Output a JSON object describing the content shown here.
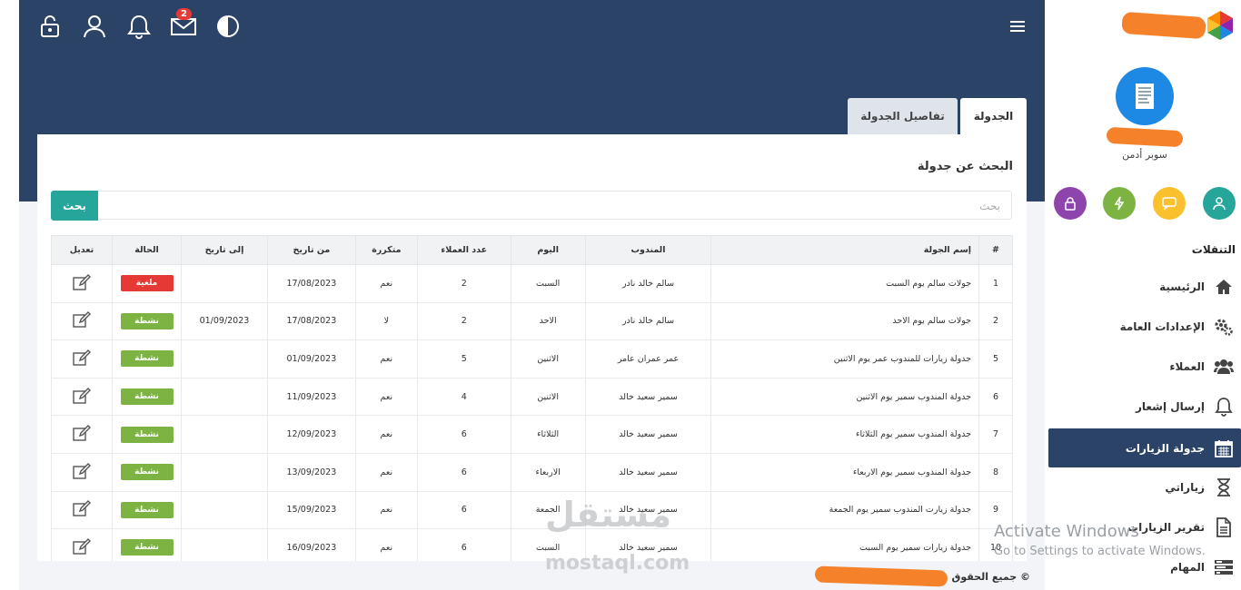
{
  "topbar": {
    "mail_badge": "2"
  },
  "sidebar": {
    "role": "سوبر أدمن",
    "nav_header": "التنقلات",
    "items": [
      {
        "label": "الرئيسية",
        "icon": "home-icon"
      },
      {
        "label": "الإعدادات العامة",
        "icon": "gears-icon"
      },
      {
        "label": "العملاء",
        "icon": "users-icon"
      },
      {
        "label": "إرسال إشعار",
        "icon": "bell-icon"
      },
      {
        "label": "جدولة الزيارات",
        "icon": "calendar-icon"
      },
      {
        "label": "زياراتي",
        "icon": "hourglass-icon"
      },
      {
        "label": "تقرير الزيارات",
        "icon": "file-icon"
      },
      {
        "label": "المهام",
        "icon": "tasks-icon"
      }
    ]
  },
  "tabs": {
    "active": "الجدولة",
    "other": "تفاصيل الجدولة"
  },
  "card": {
    "title": "البحث عن جدولة",
    "search_placeholder": "بحث",
    "search_button": "بحث"
  },
  "table": {
    "headers": {
      "num": "#",
      "name": "إسم الجولة",
      "rep": "المندوب",
      "day": "اليوم",
      "clients": "عدد العملاء",
      "recurring": "متكررة",
      "from": "من تاريخ",
      "to": "إلى تاريخ",
      "status": "الحالة",
      "edit": "تعديل"
    },
    "rows": [
      {
        "num": "1",
        "name": "جولات سالم يوم السبت",
        "rep": "سالم خالد نادر",
        "day": "السبت",
        "clients": "2",
        "recurring": "نعم",
        "from": "17/08/2023",
        "to": "",
        "status": "ملغية",
        "status_color": "#e53935"
      },
      {
        "num": "2",
        "name": "جولات سالم يوم الاحد",
        "rep": "سالم خالد نادر",
        "day": "الاحد",
        "clients": "2",
        "recurring": "لا",
        "from": "17/08/2023",
        "to": "01/09/2023",
        "status": "نشطة",
        "status_color": "#7cb342"
      },
      {
        "num": "5",
        "name": "جدولة زيارات للمندوب عمر يوم الاثنين",
        "rep": "عمر عمران عامر",
        "day": "الاثنين",
        "clients": "5",
        "recurring": "نعم",
        "from": "01/09/2023",
        "to": "",
        "status": "نشطة",
        "status_color": "#7cb342"
      },
      {
        "num": "6",
        "name": "جدولة المندوب سمير يوم الاثنين",
        "rep": "سمير سعيد خالد",
        "day": "الاثنين",
        "clients": "4",
        "recurring": "نعم",
        "from": "11/09/2023",
        "to": "",
        "status": "نشطة",
        "status_color": "#7cb342"
      },
      {
        "num": "7",
        "name": "جدولة المندوب سمير يوم الثلاثاء",
        "rep": "سمير سعيد خالد",
        "day": "الثلاثاء",
        "clients": "6",
        "recurring": "نعم",
        "from": "12/09/2023",
        "to": "",
        "status": "نشطة",
        "status_color": "#7cb342"
      },
      {
        "num": "8",
        "name": "جدولة المندوب سمير يوم الاربعاء",
        "rep": "سمير سعيد خالد",
        "day": "الاربعاء",
        "clients": "6",
        "recurring": "نعم",
        "from": "13/09/2023",
        "to": "",
        "status": "نشطة",
        "status_color": "#7cb342"
      },
      {
        "num": "9",
        "name": "جدولة زيارت المندوب سمير يوم الجمعة",
        "rep": "سمير سعيد خالد",
        "day": "الجمعة",
        "clients": "6",
        "recurring": "نعم",
        "from": "15/09/2023",
        "to": "",
        "status": "نشطة",
        "status_color": "#7cb342"
      },
      {
        "num": "10",
        "name": "جدولة زيارات سمير يوم السبت",
        "rep": "سمير سعيد خالد",
        "day": "السبت",
        "clients": "6",
        "recurring": "نعم",
        "from": "16/09/2023",
        "to": "",
        "status": "نشطة",
        "status_color": "#7cb342"
      }
    ]
  },
  "footer": {
    "text": "جميع الحقوق ©"
  },
  "watermark": {
    "activate_title": "Activate Windows",
    "activate_sub": "Go to Settings to activate Windows.",
    "site_ar": "مستقل",
    "site_en": "mostaql.com"
  }
}
